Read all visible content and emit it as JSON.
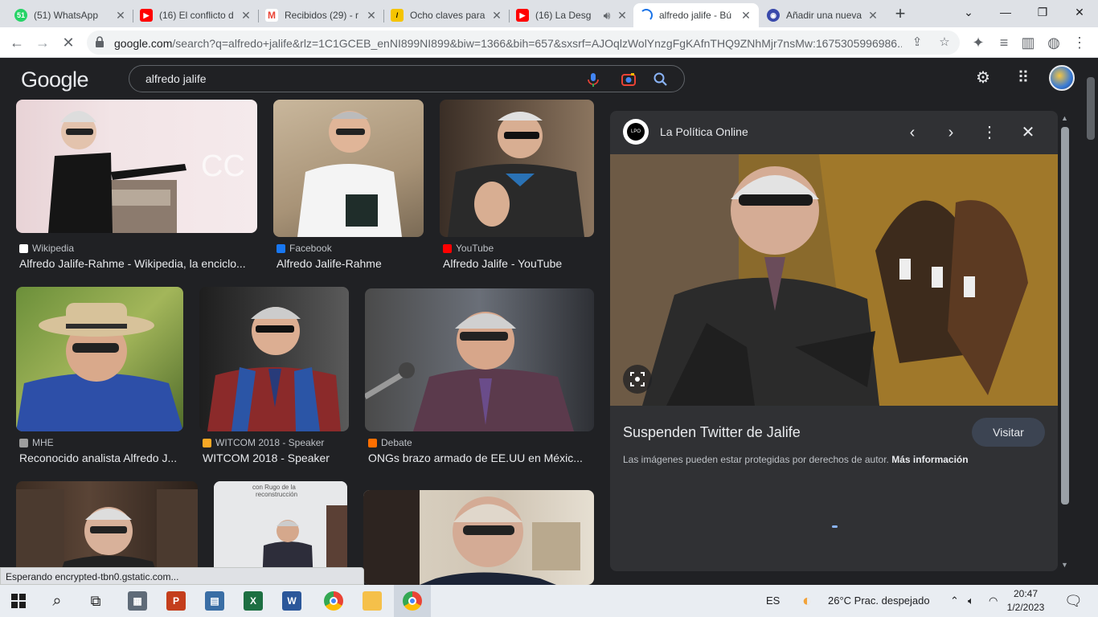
{
  "browser": {
    "tabs": [
      {
        "title": "(51) WhatsApp",
        "icon": "whatsapp-icon",
        "color": "#25d366",
        "badge": "51"
      },
      {
        "title": "(16) El conflicto d",
        "icon": "youtube-icon",
        "color": "#ff0000"
      },
      {
        "title": "Recibidos (29) - r",
        "icon": "gmail-icon",
        "color": "#ea4335"
      },
      {
        "title": "Ocho claves para",
        "icon": "news-icon",
        "color": "#f5c400"
      },
      {
        "title": "(16) La Desg",
        "icon": "youtube-icon",
        "color": "#ff0000"
      },
      {
        "title": "alfredo jalife - Bú",
        "icon": "loading-icon",
        "color": "#1a73e8"
      },
      {
        "title": "Añadir una nueva",
        "icon": "site-icon",
        "color": "#3949ab"
      }
    ],
    "url_host": "google.com",
    "url_rest": "/search?q=alfredo+jalife&rlz=1C1GCEB_enNI899NI899&biw=1366&bih=657&sxsrf=AJOqlzWolYnzgFgKAfnTHQ9ZNhMjr7nsMw:1675305996986..."
  },
  "google": {
    "logo": "Google",
    "query": "alfredo jalife"
  },
  "results": [
    {
      "source": "Wikipedia",
      "title": "Alfredo Jalife-Rahme - Wikipedia, la enciclo...",
      "src_color": "#ffffff"
    },
    {
      "source": "Facebook",
      "title": "Alfredo Jalife-Rahme",
      "src_color": "#1877f2"
    },
    {
      "source": "YouTube",
      "title": "Alfredo Jalife - YouTube",
      "src_color": "#ff0000"
    },
    {
      "source": "MHE",
      "title": "Reconocido analista Alfredo J...",
      "src_color": "#9e9e9e"
    },
    {
      "source": "WITCOM 2018 - Speaker",
      "title": "WITCOM 2018 - Speaker",
      "src_color": "#f9a825"
    },
    {
      "source": "Debate",
      "title": "ONGs brazo armado de EE.UU en Méxic...",
      "src_color": "#ff6f00"
    }
  ],
  "panel": {
    "site": "La Política Online",
    "logo_text": "LPO",
    "title": "Suspenden Twitter de Jalife",
    "visit_label": "Visitar",
    "note": "Las imágenes pueden estar protegidas por derechos de autor.",
    "note_link": "Más información"
  },
  "status_text": "Esperando encrypted-tbn0.gstatic.com...",
  "taskbar": {
    "lang": "ES",
    "weather": "26°C  Prac. despejado",
    "time": "20:47",
    "date": "1/2/2023"
  }
}
